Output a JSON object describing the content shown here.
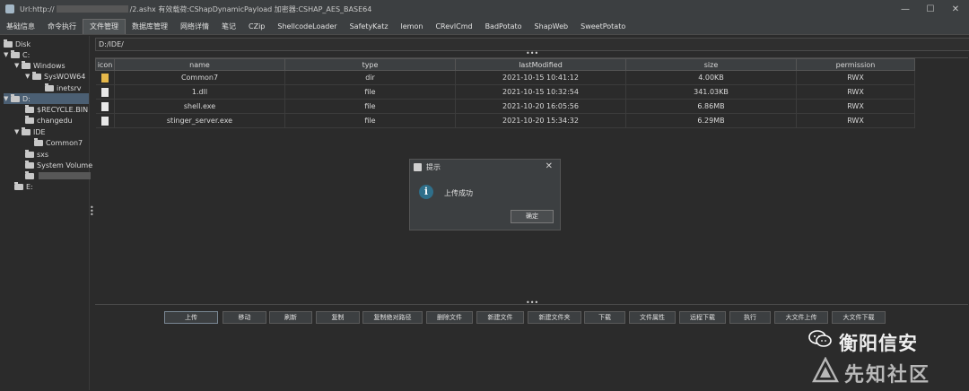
{
  "window": {
    "title_prefix": "Url:http://",
    "title_suffix": "/2.ashx 有效载荷:CShapDynamicPayload 加密器:CSHAP_AES_BASE64",
    "controls": [
      "—",
      "☐",
      "✕"
    ]
  },
  "menu": {
    "tabs": [
      "基础信息",
      "命令执行",
      "文件管理",
      "数据库管理",
      "网络详情",
      "笔记",
      "CZip",
      "ShellcodeLoader",
      "SafetyKatz",
      "lemon",
      "CRevlCmd",
      "BadPotato",
      "ShapWeb",
      "SweetPotato"
    ],
    "active_tab": "文件管理"
  },
  "tree": {
    "root": "Disk",
    "nodes": [
      "C:",
      "Windows",
      "SysWOW64",
      "inetsrv",
      "D:",
      "$RECYCLE.BIN",
      "changedu",
      "IDE",
      "Common7",
      "sxs",
      "System Volume",
      "E:"
    ]
  },
  "path": {
    "value": "D:/IDE/"
  },
  "table": {
    "headers": [
      "icon",
      "name",
      "type",
      "lastModified",
      "size",
      "permission"
    ],
    "rows": [
      {
        "icon": "folder-icon",
        "name": "Common7",
        "type": "dir",
        "lastModified": "2021-10-15 10:41:12",
        "size": "4.00KB",
        "permission": "RWX"
      },
      {
        "icon": "file-icon",
        "name": "1.dll",
        "type": "file",
        "lastModified": "2021-10-15 10:32:54",
        "size": "341.03KB",
        "permission": "RWX"
      },
      {
        "icon": "file-icon",
        "name": "shell.exe",
        "type": "file",
        "lastModified": "2021-10-20 16:05:56",
        "size": "6.86MB",
        "permission": "RWX"
      },
      {
        "icon": "file-icon",
        "name": "stinger_server.exe",
        "type": "file",
        "lastModified": "2021-10-20 15:34:32",
        "size": "6.29MB",
        "permission": "RWX"
      }
    ]
  },
  "buttons": [
    "上传",
    "移动",
    "刷新",
    "复制",
    "复制绝对路径",
    "删除文件",
    "新建文件",
    "新建文件夹",
    "下载",
    "文件属性",
    "远程下载",
    "执行",
    "大文件上传",
    "大文件下载"
  ],
  "dialog": {
    "title": "提示",
    "message": "上传成功",
    "ok_label": "确定",
    "close": "✕",
    "icon_glyph": "i"
  },
  "watermark": {
    "account": "衡阳信安",
    "site": "先知社区"
  },
  "splitter": {
    "dots": "•••"
  }
}
